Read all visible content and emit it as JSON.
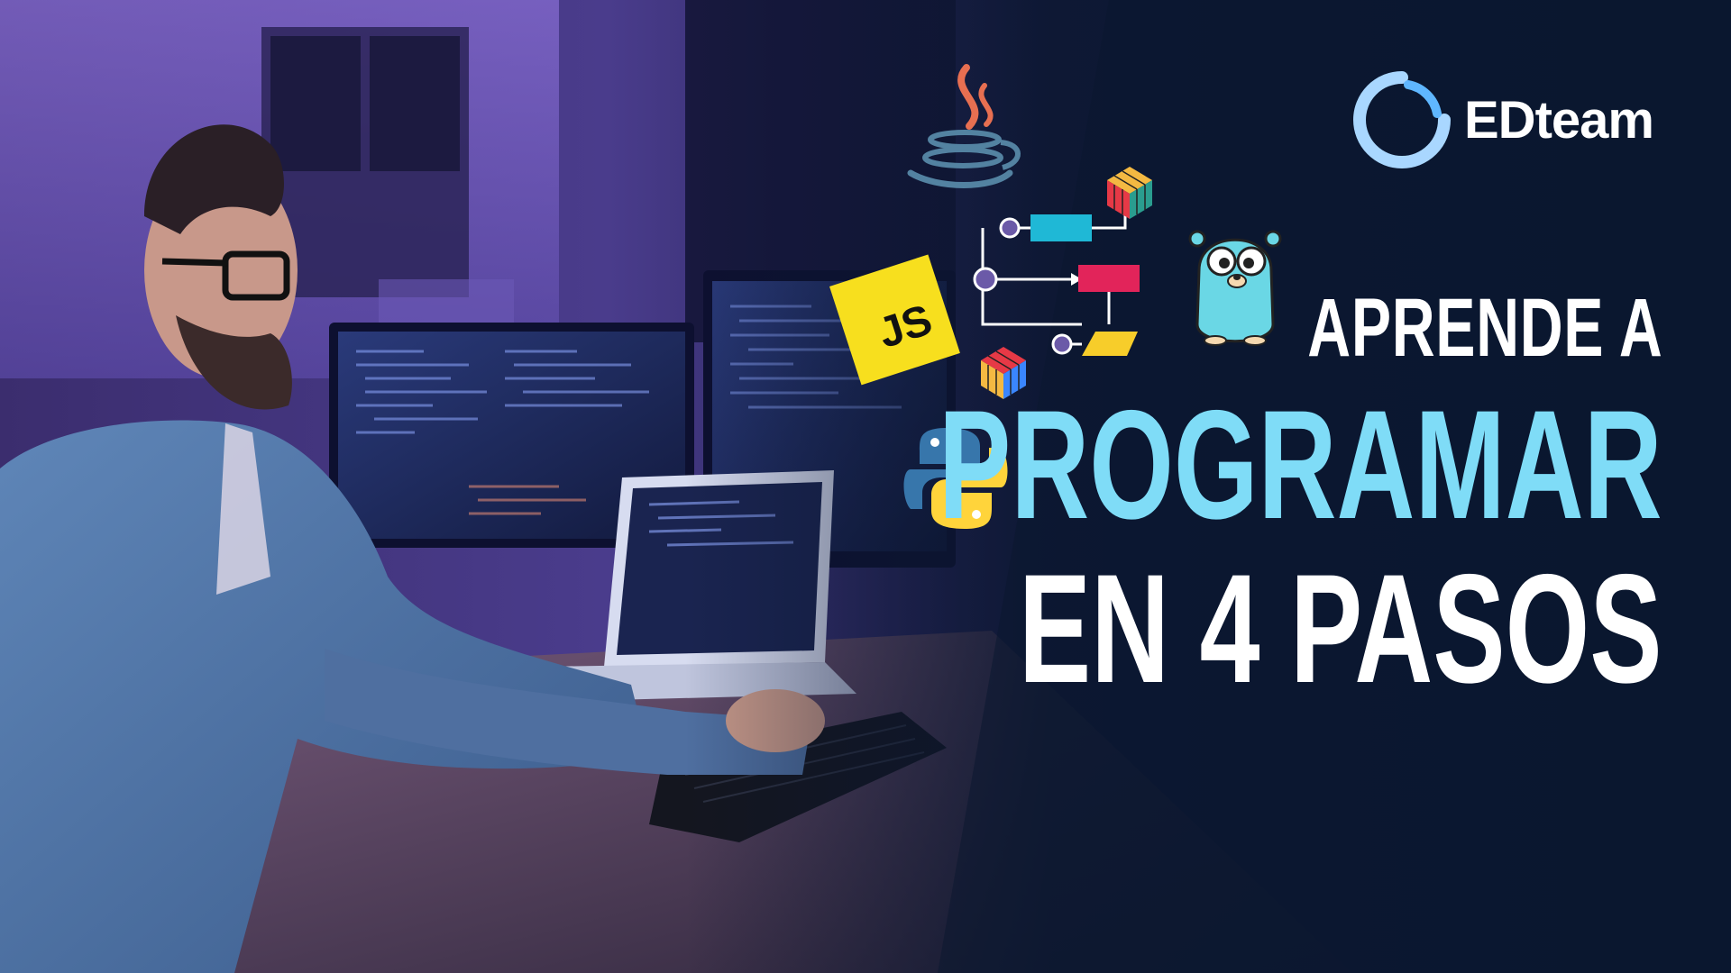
{
  "brand": {
    "name": "EDteam"
  },
  "headline": {
    "line1": "APRENDE A",
    "line2": "PROGRAMAR",
    "line3": "EN 4 PASOS"
  },
  "badges": {
    "javascript": "JS"
  },
  "icons": [
    "java-logo-icon",
    "javascript-logo-icon",
    "python-logo-icon",
    "go-gopher-icon",
    "rubiks-cube-icon",
    "flowchart-icon",
    "edteam-logo-icon"
  ],
  "colors": {
    "accent_cyan": "#7fdcf7",
    "headline_white": "#ffffff",
    "background_navy": "#0b1730",
    "js_yellow": "#f7df1e"
  }
}
